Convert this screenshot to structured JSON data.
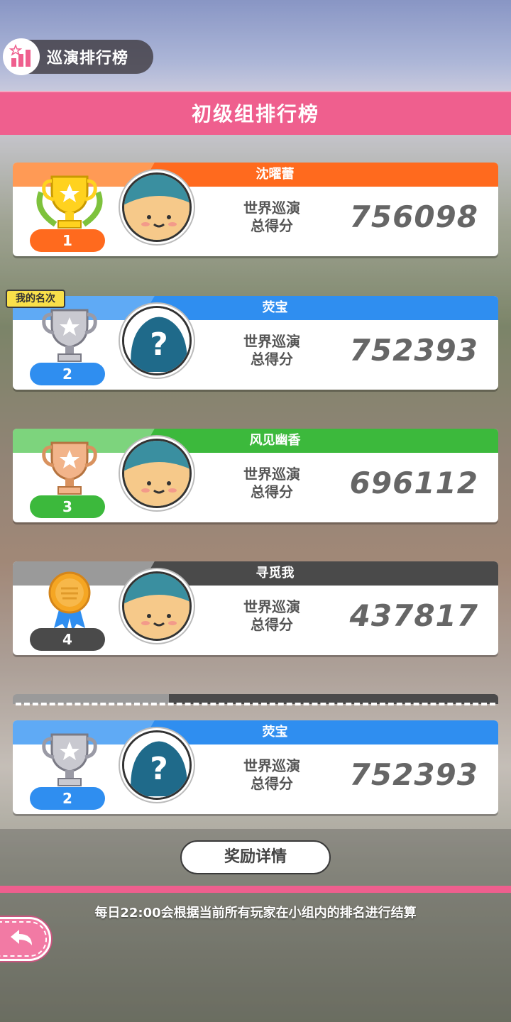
{
  "header": {
    "tag_title": "巡演排行榜",
    "group_title": "初级组排行榜"
  },
  "my_rank_tag": "我的名次",
  "score_label": [
    "世界巡演",
    "总得分"
  ],
  "colors": {
    "gold": "#ff6a1e",
    "gold_light": "#ff9a55",
    "silver": "#2f8ef0",
    "silver_light": "#5faaf5",
    "bronze": "#3cb93c",
    "bronze_light": "#7dd47d",
    "fourth": "#4a4a4a",
    "fourth_light": "#9a9a9a",
    "accent": "#ef5f8e"
  },
  "rankings": [
    {
      "rank": "1",
      "name": "沈曜蕾",
      "score": "756098",
      "avatar": "cat-avatar",
      "trophy": "gold-trophy-icon"
    },
    {
      "rank": "2",
      "name": "荧宝",
      "score": "752393",
      "avatar": "question-avatar",
      "trophy": "silver-trophy-icon"
    },
    {
      "rank": "3",
      "name": "风见幽香",
      "score": "696112",
      "avatar": "cat-avatar",
      "trophy": "bronze-trophy-icon"
    },
    {
      "rank": "4",
      "name": "寻觅我",
      "score": "437817",
      "avatar": "cat-avatar",
      "trophy": "medal-icon"
    }
  ],
  "my_entry": {
    "rank": "2",
    "name": "荧宝",
    "score": "752393",
    "avatar": "question-avatar",
    "trophy": "silver-trophy-icon"
  },
  "reward_button": "奖励详情",
  "notice": "每日22:00会根据当前所有玩家在小组内的排名进行结算"
}
